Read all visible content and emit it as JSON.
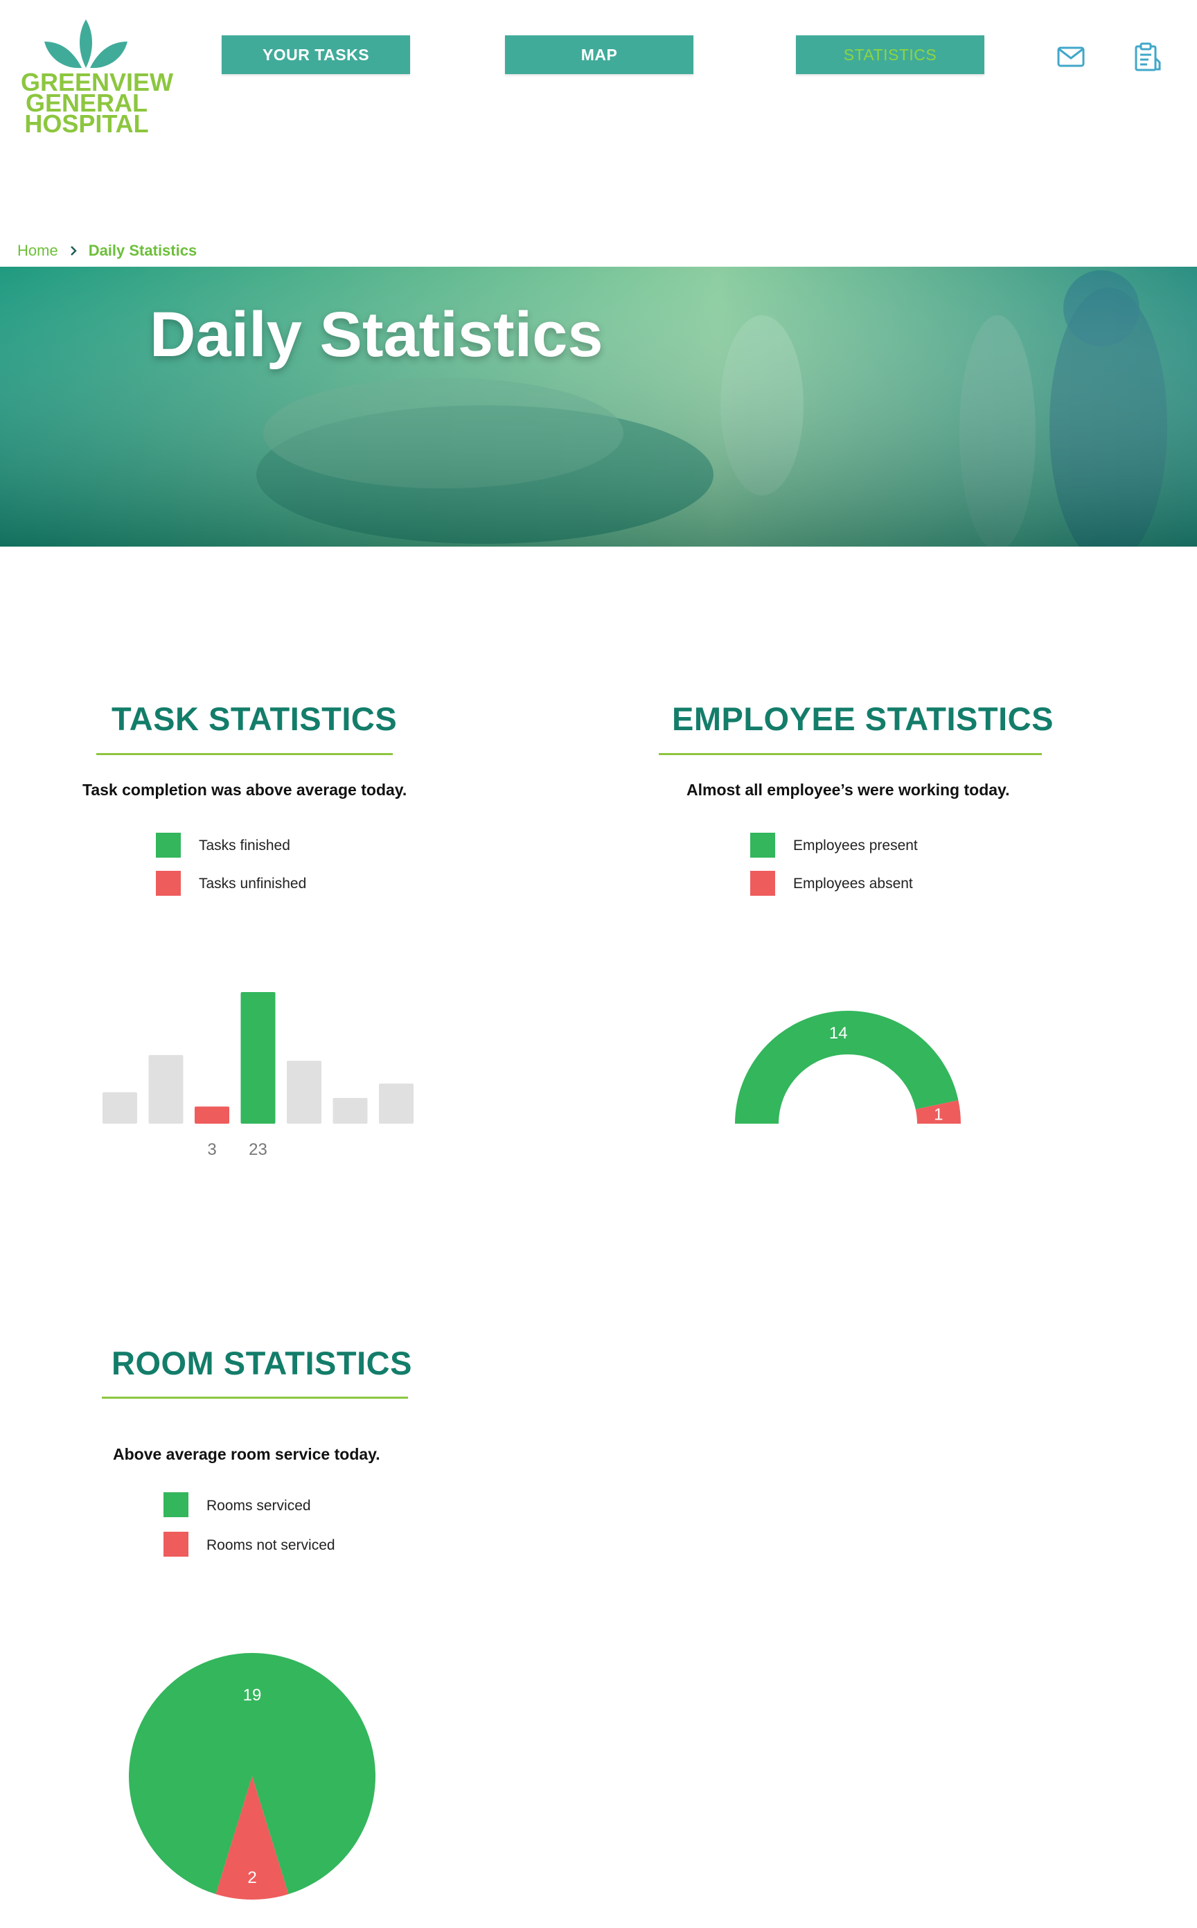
{
  "brand": {
    "logo_text": [
      "GREENVIEW",
      "GENERAL",
      "HOSPITAL"
    ],
    "primary_color": "#41ab9a",
    "accent_color": "#8cc63f",
    "heading_color": "#137d6a"
  },
  "nav": {
    "tasks_label": "YOUR TASKS",
    "map_label": "MAP",
    "statistics_label": "STATISTICS",
    "active": "STATISTICS",
    "icons": [
      "mail-icon",
      "clipboard-icon"
    ]
  },
  "breadcrumb": {
    "home": "Home",
    "current": "Daily Statistics"
  },
  "hero": {
    "title": "Daily Statistics"
  },
  "task_stats": {
    "title": "TASK STATISTICS",
    "summary": "Task completion was above average today.",
    "legend": [
      {
        "label": "Tasks finished",
        "color": "#33b65c"
      },
      {
        "label": "Tasks unfinished",
        "color": "#ee5c5c"
      }
    ]
  },
  "employee_stats": {
    "title": "EMPLOYEE STATISTICS",
    "summary": "Almost all employee’s were working today.",
    "legend": [
      {
        "label": "Employees present",
        "color": "#33b65c"
      },
      {
        "label": "Employees absent",
        "color": "#ee5c5c"
      }
    ]
  },
  "room_stats": {
    "title": "ROOM STATISTICS",
    "summary": "Above average room service today.",
    "legend": [
      {
        "label": "Rooms serviced",
        "color": "#33b65c"
      },
      {
        "label": "Rooms not serviced",
        "color": "#ee5c5c"
      }
    ]
  },
  "chart_data": [
    {
      "type": "bar",
      "title": "",
      "categories": [
        "",
        "",
        "",
        "",
        "",
        "",
        ""
      ],
      "values": [
        5.5,
        12,
        3,
        23,
        11,
        4.5,
        7
      ],
      "labeled": [
        false,
        false,
        true,
        true,
        false,
        false,
        false
      ],
      "colors": [
        "#e0e0e0",
        "#e0e0e0",
        "#ee5c5c",
        "#33b65c",
        "#e0e0e0",
        "#e0e0e0",
        "#e0e0e0"
      ],
      "value_labels": [
        "",
        "",
        "3",
        "23",
        "",
        "",
        ""
      ],
      "ylim": [
        0,
        23
      ]
    },
    {
      "type": "pie",
      "variant": "half-donut",
      "series": [
        {
          "name": "Employees present",
          "value": 14,
          "color": "#33b65c"
        },
        {
          "name": "Employees absent",
          "value": 1,
          "color": "#ee5c5c"
        }
      ],
      "value_labels": [
        "14",
        "1"
      ]
    },
    {
      "type": "pie",
      "series": [
        {
          "name": "Rooms serviced",
          "value": 19,
          "color": "#33b65c"
        },
        {
          "name": "Rooms not serviced",
          "value": 2,
          "color": "#ee5c5c"
        }
      ],
      "value_labels": [
        "19",
        "2"
      ]
    }
  ]
}
